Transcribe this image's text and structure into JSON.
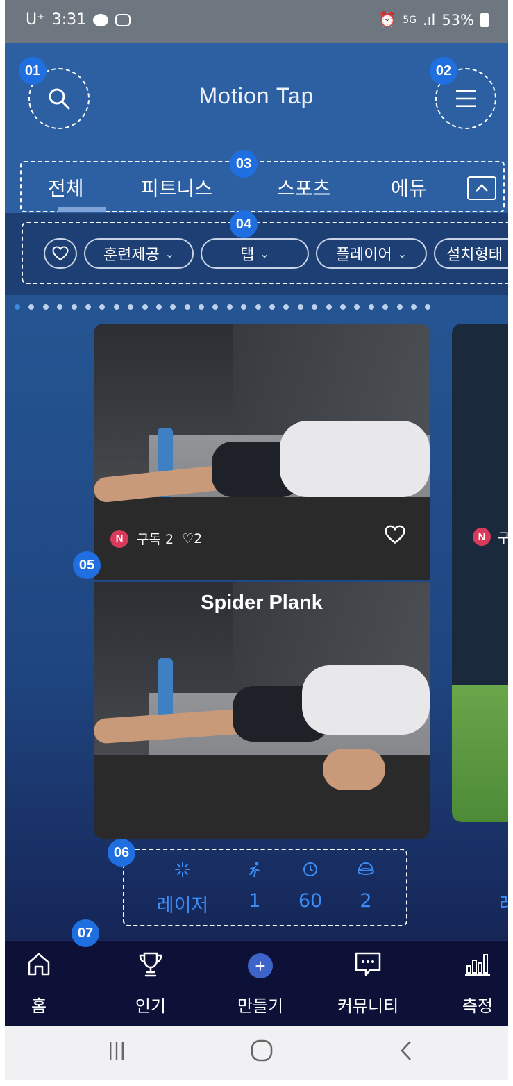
{
  "status_bar": {
    "carrier": "U⁺",
    "time": "3:31",
    "network": "5G",
    "battery": "53%"
  },
  "header": {
    "title": "Motion Tap"
  },
  "badges": {
    "search": "01",
    "menu": "02",
    "tabs": "03",
    "filters": "04",
    "card": "05",
    "stats": "06",
    "nav": "07"
  },
  "tabs": [
    {
      "label": "전체"
    },
    {
      "label": "피트니스"
    },
    {
      "label": "스포츠"
    },
    {
      "label": "에듀"
    }
  ],
  "filters": [
    {
      "label": "훈련제공"
    },
    {
      "label": "탭"
    },
    {
      "label": "플레이어"
    },
    {
      "label": "설치형태"
    }
  ],
  "pagination": {
    "dot_count": 30,
    "active_index": 0
  },
  "cards": [
    {
      "avatar": "N",
      "subscribers": "구독 2",
      "likes": "♡2",
      "title": "Spider Plank"
    },
    {
      "avatar": "N",
      "subscribers": "구"
    }
  ],
  "stats": {
    "sensor": "레이저",
    "players": "1",
    "time": "60",
    "count": "2",
    "next_sensor": "레"
  },
  "bottom_nav": [
    {
      "label": "홈",
      "icon": "home-icon"
    },
    {
      "label": "인기",
      "icon": "trophy-icon"
    },
    {
      "label": "만들기",
      "icon": "plus-icon"
    },
    {
      "label": "커뮤니티",
      "icon": "chat-icon"
    },
    {
      "label": "측정",
      "icon": "bar-chart-icon"
    }
  ],
  "colors": {
    "header_bg": "#2c60a3",
    "badge": "#1f6fe0",
    "accent": "#3b8cf5",
    "nav_bg": "#0d1138"
  }
}
